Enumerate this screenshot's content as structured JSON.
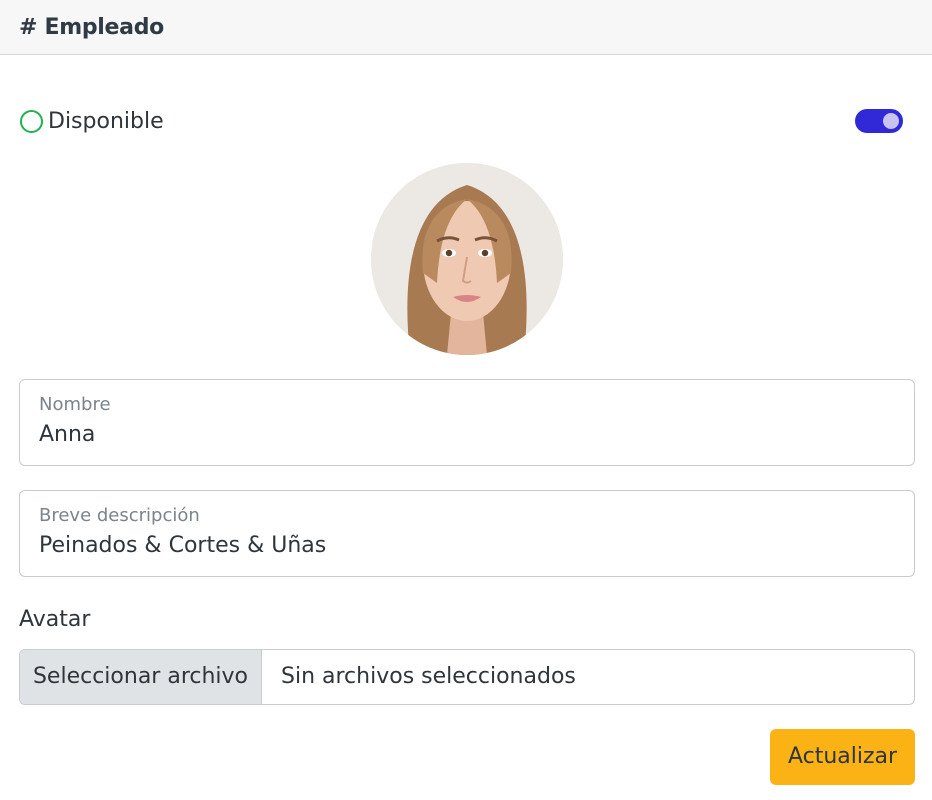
{
  "header": {
    "title": "# Empleado"
  },
  "status": {
    "label": "Disponible",
    "available": true,
    "color": "#22b14c"
  },
  "toggle": {
    "on": true,
    "color": "#3128d8"
  },
  "avatar": {
    "description": "employee-photo"
  },
  "fields": {
    "name": {
      "label": "Nombre",
      "value": "Anna"
    },
    "description": {
      "label": "Breve descripción",
      "value": "Peinados & Cortes & Uñas"
    }
  },
  "file": {
    "label": "Avatar",
    "button_label": "Seleccionar archivo",
    "status": "Sin archivos seleccionados"
  },
  "actions": {
    "submit_label": "Actualizar",
    "submit_color": "#fbb214"
  }
}
